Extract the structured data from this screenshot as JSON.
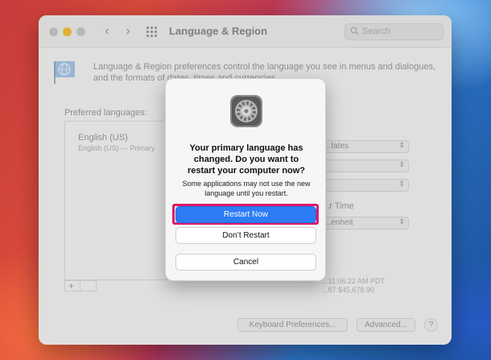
{
  "window": {
    "title": "Language & Region",
    "search_placeholder": "Search",
    "description": "Language & Region preferences control the language you see in menus and dialogues, and the formats of dates, times and currencies.",
    "preferred_languages_label": "Preferred languages:",
    "languages": [
      {
        "name": "English (US)",
        "detail": "English (US) — Primary"
      }
    ],
    "popups": [
      "...tates",
      "",
      "",
      "...enheit"
    ],
    "time_label": "...r Time",
    "samples": [
      "...11:06:22 AM PDT",
      "...87   $45,678.90"
    ],
    "add_label": "+",
    "keyboard_prefs_label": "Keyboard Preferences...",
    "advanced_label": "Advanced...",
    "help_label": "?"
  },
  "dialog": {
    "title": "Your primary language has changed. Do you want to restart your computer now?",
    "message": "Some applications may not use the new language until you restart.",
    "restart_now_label": "Restart Now",
    "dont_restart_label": "Don’t Restart",
    "cancel_label": "Cancel"
  },
  "colors": {
    "accent": "#2d7cf6",
    "highlight": "#e0196b"
  }
}
